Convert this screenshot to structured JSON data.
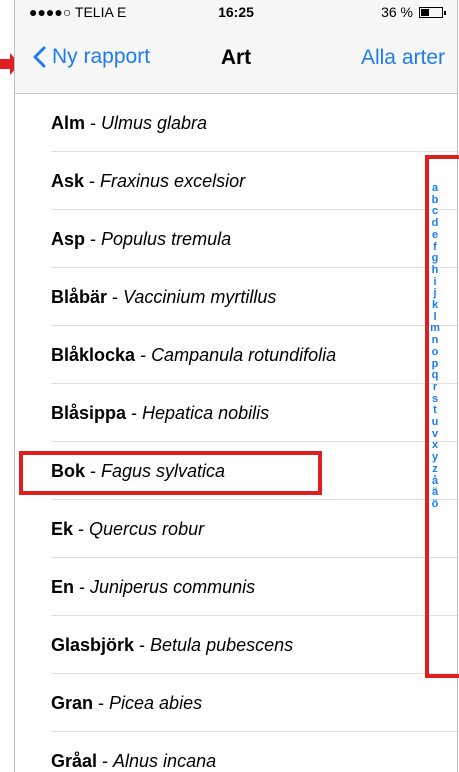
{
  "status_bar": {
    "carrier": "●●●●○ TELIA  E",
    "time": "16:25",
    "battery": "36 %",
    "battery_level": 0.36
  },
  "nav": {
    "back_label": "Ny rapport",
    "title": "Art",
    "right_label": "Alla arter"
  },
  "species": [
    {
      "common": "Alm",
      "latin": "Ulmus glabra"
    },
    {
      "common": "Ask",
      "latin": "Fraxinus excelsior"
    },
    {
      "common": "Asp",
      "latin": "Populus tremula"
    },
    {
      "common": "Blåbär",
      "latin": "Vaccinium myrtillus"
    },
    {
      "common": "Blåklocka",
      "latin": "Campanula rotundifolia"
    },
    {
      "common": "Blåsippa",
      "latin": "Hepatica nobilis"
    },
    {
      "common": "Bok",
      "latin": "Fagus sylvatica"
    },
    {
      "common": "Ek",
      "latin": "Quercus robur"
    },
    {
      "common": "En",
      "latin": "Juniperus communis"
    },
    {
      "common": "Glasbjörk",
      "latin": "Betula pubescens"
    },
    {
      "common": "Gran",
      "latin": "Picea abies"
    },
    {
      "common": "Gråal",
      "latin": "Alnus incana"
    }
  ],
  "index_letters": [
    "a",
    "b",
    "c",
    "d",
    "e",
    "f",
    "g",
    "h",
    "i",
    "j",
    "k",
    "l",
    "m",
    "n",
    "o",
    "p",
    "q",
    "r",
    "s",
    "t",
    "u",
    "v",
    "x",
    "y",
    "z",
    "å",
    "ä",
    "ö"
  ],
  "colors": {
    "accent": "#1d7cf2",
    "highlight": "#e02020",
    "separator": "#e0e0e0"
  }
}
